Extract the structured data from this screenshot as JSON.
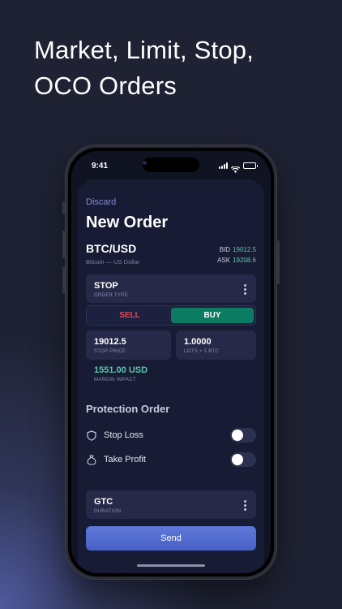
{
  "promo": {
    "line1": "Market, Limit, Stop,",
    "line2": "OCO Orders"
  },
  "status_bar": {
    "time": "9:41",
    "icons": [
      "signal-icon",
      "wifi-icon",
      "battery-icon"
    ]
  },
  "order": {
    "discard_label": "Discard",
    "title": "New Order",
    "symbol": "BTC/USD",
    "symbol_name": "Bitcoin — US Dollar",
    "bid_label": "BID",
    "bid_value": "19012.5",
    "ask_label": "ASK",
    "ask_value": "19208.6",
    "order_type": {
      "value": "STOP",
      "label": "ORDER TYPE"
    },
    "side": {
      "sell_label": "SELL",
      "buy_label": "BUY",
      "selected": "BUY"
    },
    "stop_price": {
      "value": "19012.5",
      "label": "STOP PRICE"
    },
    "lots": {
      "value": "1.0000",
      "label": "LOTS × 1 BTC"
    },
    "margin": {
      "value": "1551.00 USD",
      "label": "MARGIN IMPACT"
    },
    "protection": {
      "title": "Protection Order",
      "stop_loss_label": "Stop Loss",
      "stop_loss_enabled": false,
      "take_profit_label": "Take Profit",
      "take_profit_enabled": false
    },
    "duration": {
      "value": "GTC",
      "label": "DURATION"
    },
    "send_label": "Send"
  },
  "colors": {
    "accent": "#4760c6",
    "buy": "#0b7b62",
    "sell": "#e0485a",
    "positive": "#5ac6ad",
    "link": "#7f8fd6"
  }
}
